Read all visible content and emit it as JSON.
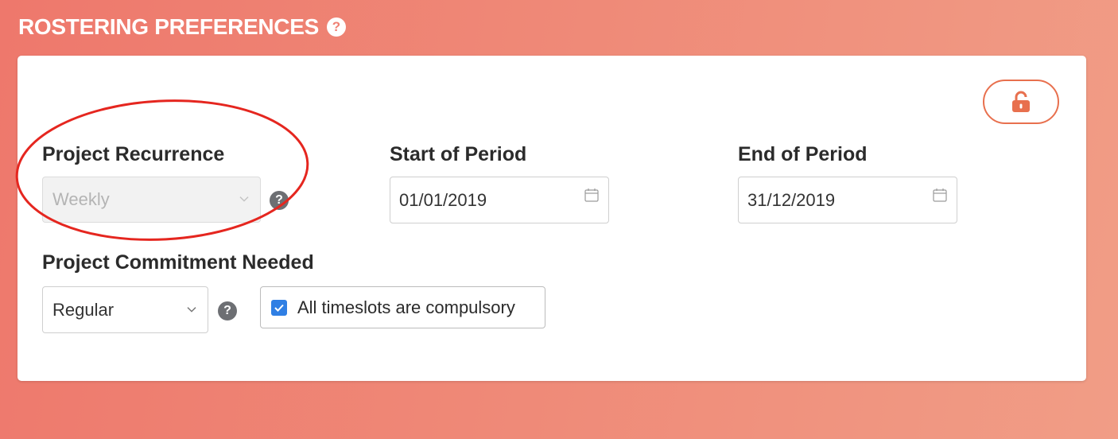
{
  "section": {
    "title": "ROSTERING PREFERENCES",
    "help_icon": "question-circle-icon"
  },
  "lock": {
    "icon": "unlock-icon",
    "color": "#e8704e"
  },
  "recurrence": {
    "label": "Project Recurrence",
    "value": "Weekly",
    "disabled": true,
    "help_icon": "question-circle-icon"
  },
  "start": {
    "label": "Start of Period",
    "value": "01/01/2019",
    "icon": "calendar-icon"
  },
  "end": {
    "label": "End of Period",
    "value": "31/12/2019",
    "icon": "calendar-icon"
  },
  "commitment": {
    "label": "Project Commitment Needed",
    "value": "Regular",
    "help_icon": "question-circle-icon"
  },
  "compulsory": {
    "label": "All timeslots are compulsory",
    "checked": true
  },
  "colors": {
    "background_start": "#ee786c",
    "background_end": "#f19d86",
    "accent": "#e8704e",
    "checkbox": "#2f7fe4",
    "annotation": "#e5261f"
  }
}
